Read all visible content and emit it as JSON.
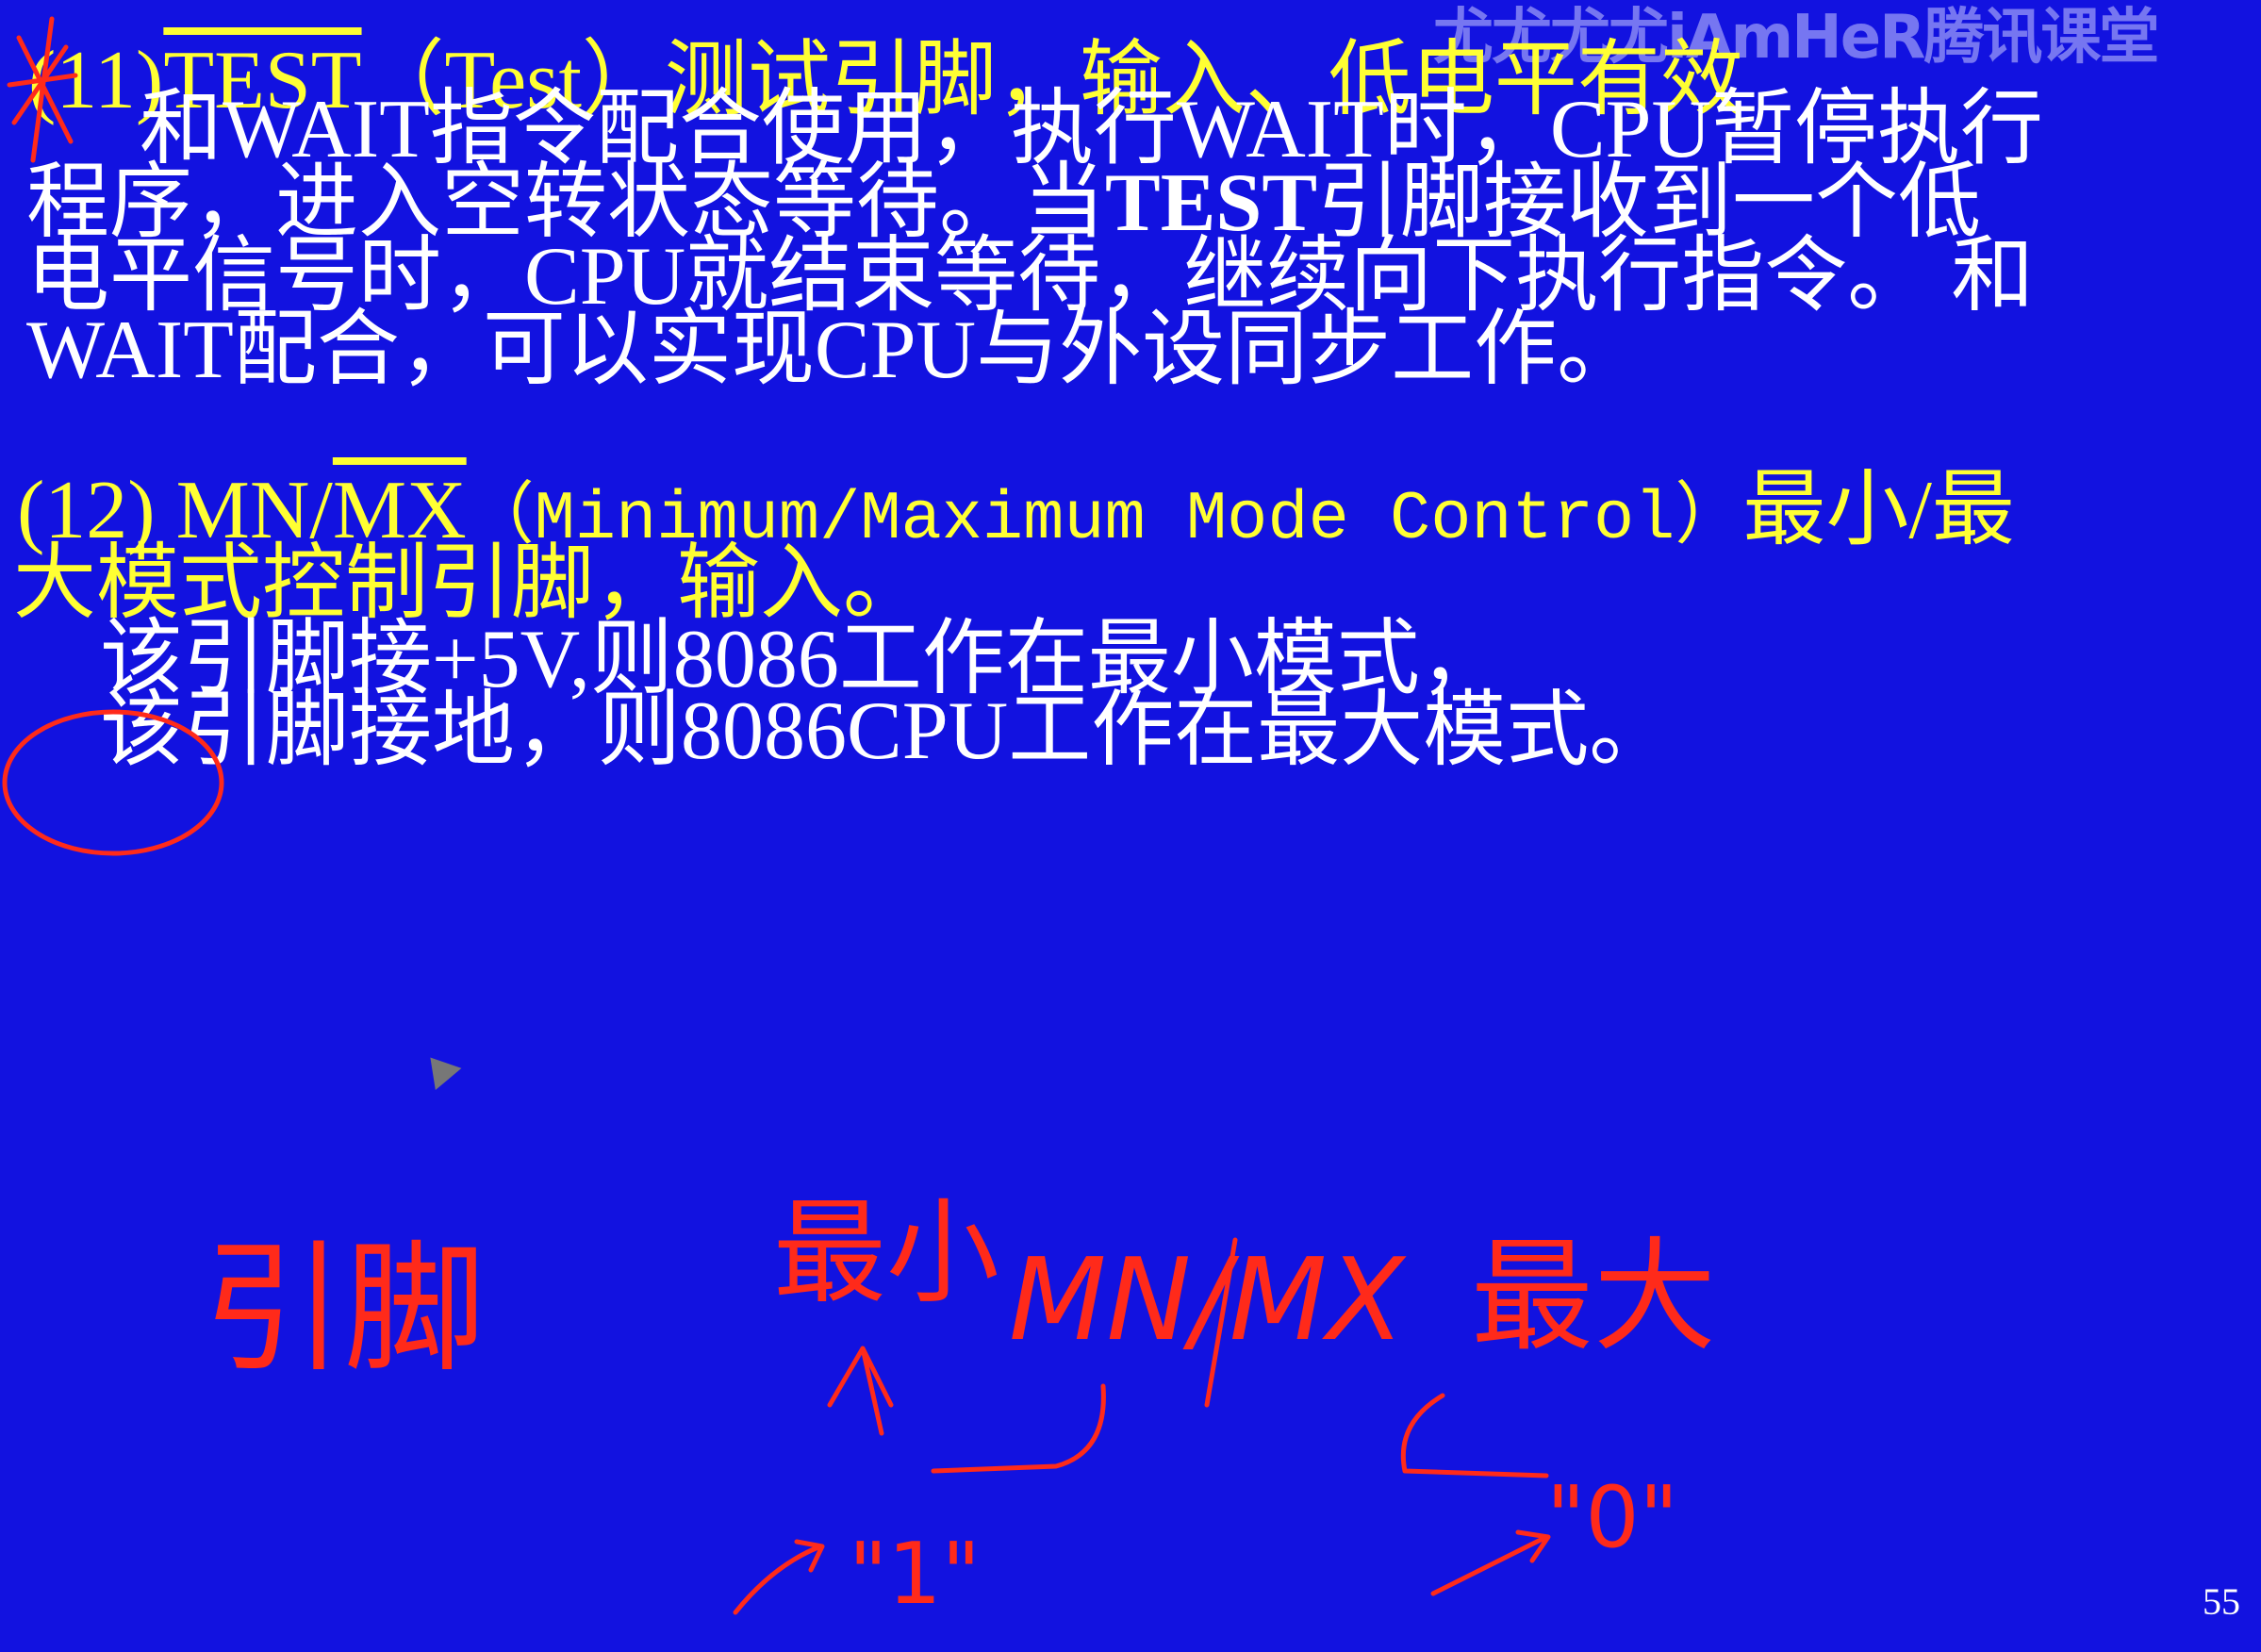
{
  "watermark": "尤尤尤尤iAmHeR腾讯课堂",
  "page_number": "55",
  "item11": {
    "number": "(11)",
    "pin": "TEST",
    "english": "（Test）",
    "desc": "测试引脚，输入、低电平有效",
    "para": [
      "和WAIT指令配合使用，执行WAIT时，CPU暂停执行",
      [
        "程序，进入空转状态等待。当",
        "TEST",
        "引脚接收到一个低"
      ],
      "电平信号时，CPU就结束等待，继续向下执行指令。 和",
      "WAIT配合，可以实现CPU与外设同步工作。"
    ]
  },
  "item12": {
    "number": "(12)",
    "pin_mn": "MN/",
    "pin_mx": "MX",
    "english": "（Minimum/Maximum Mode Control）",
    "desc_tail": "最小/最",
    "desc_line2": "大模式控制引脚，输入。",
    "lines": [
      "该引脚接+5V,则8086工作在最小模式，",
      "该引脚接地，则8086CPU工作在最大模式。"
    ]
  },
  "annotations": {
    "pin": "引脚",
    "min": "最小",
    "mnmx": "MN/MX",
    "max": "最大",
    "one": "\"1\"",
    "zero": "\"0\""
  }
}
